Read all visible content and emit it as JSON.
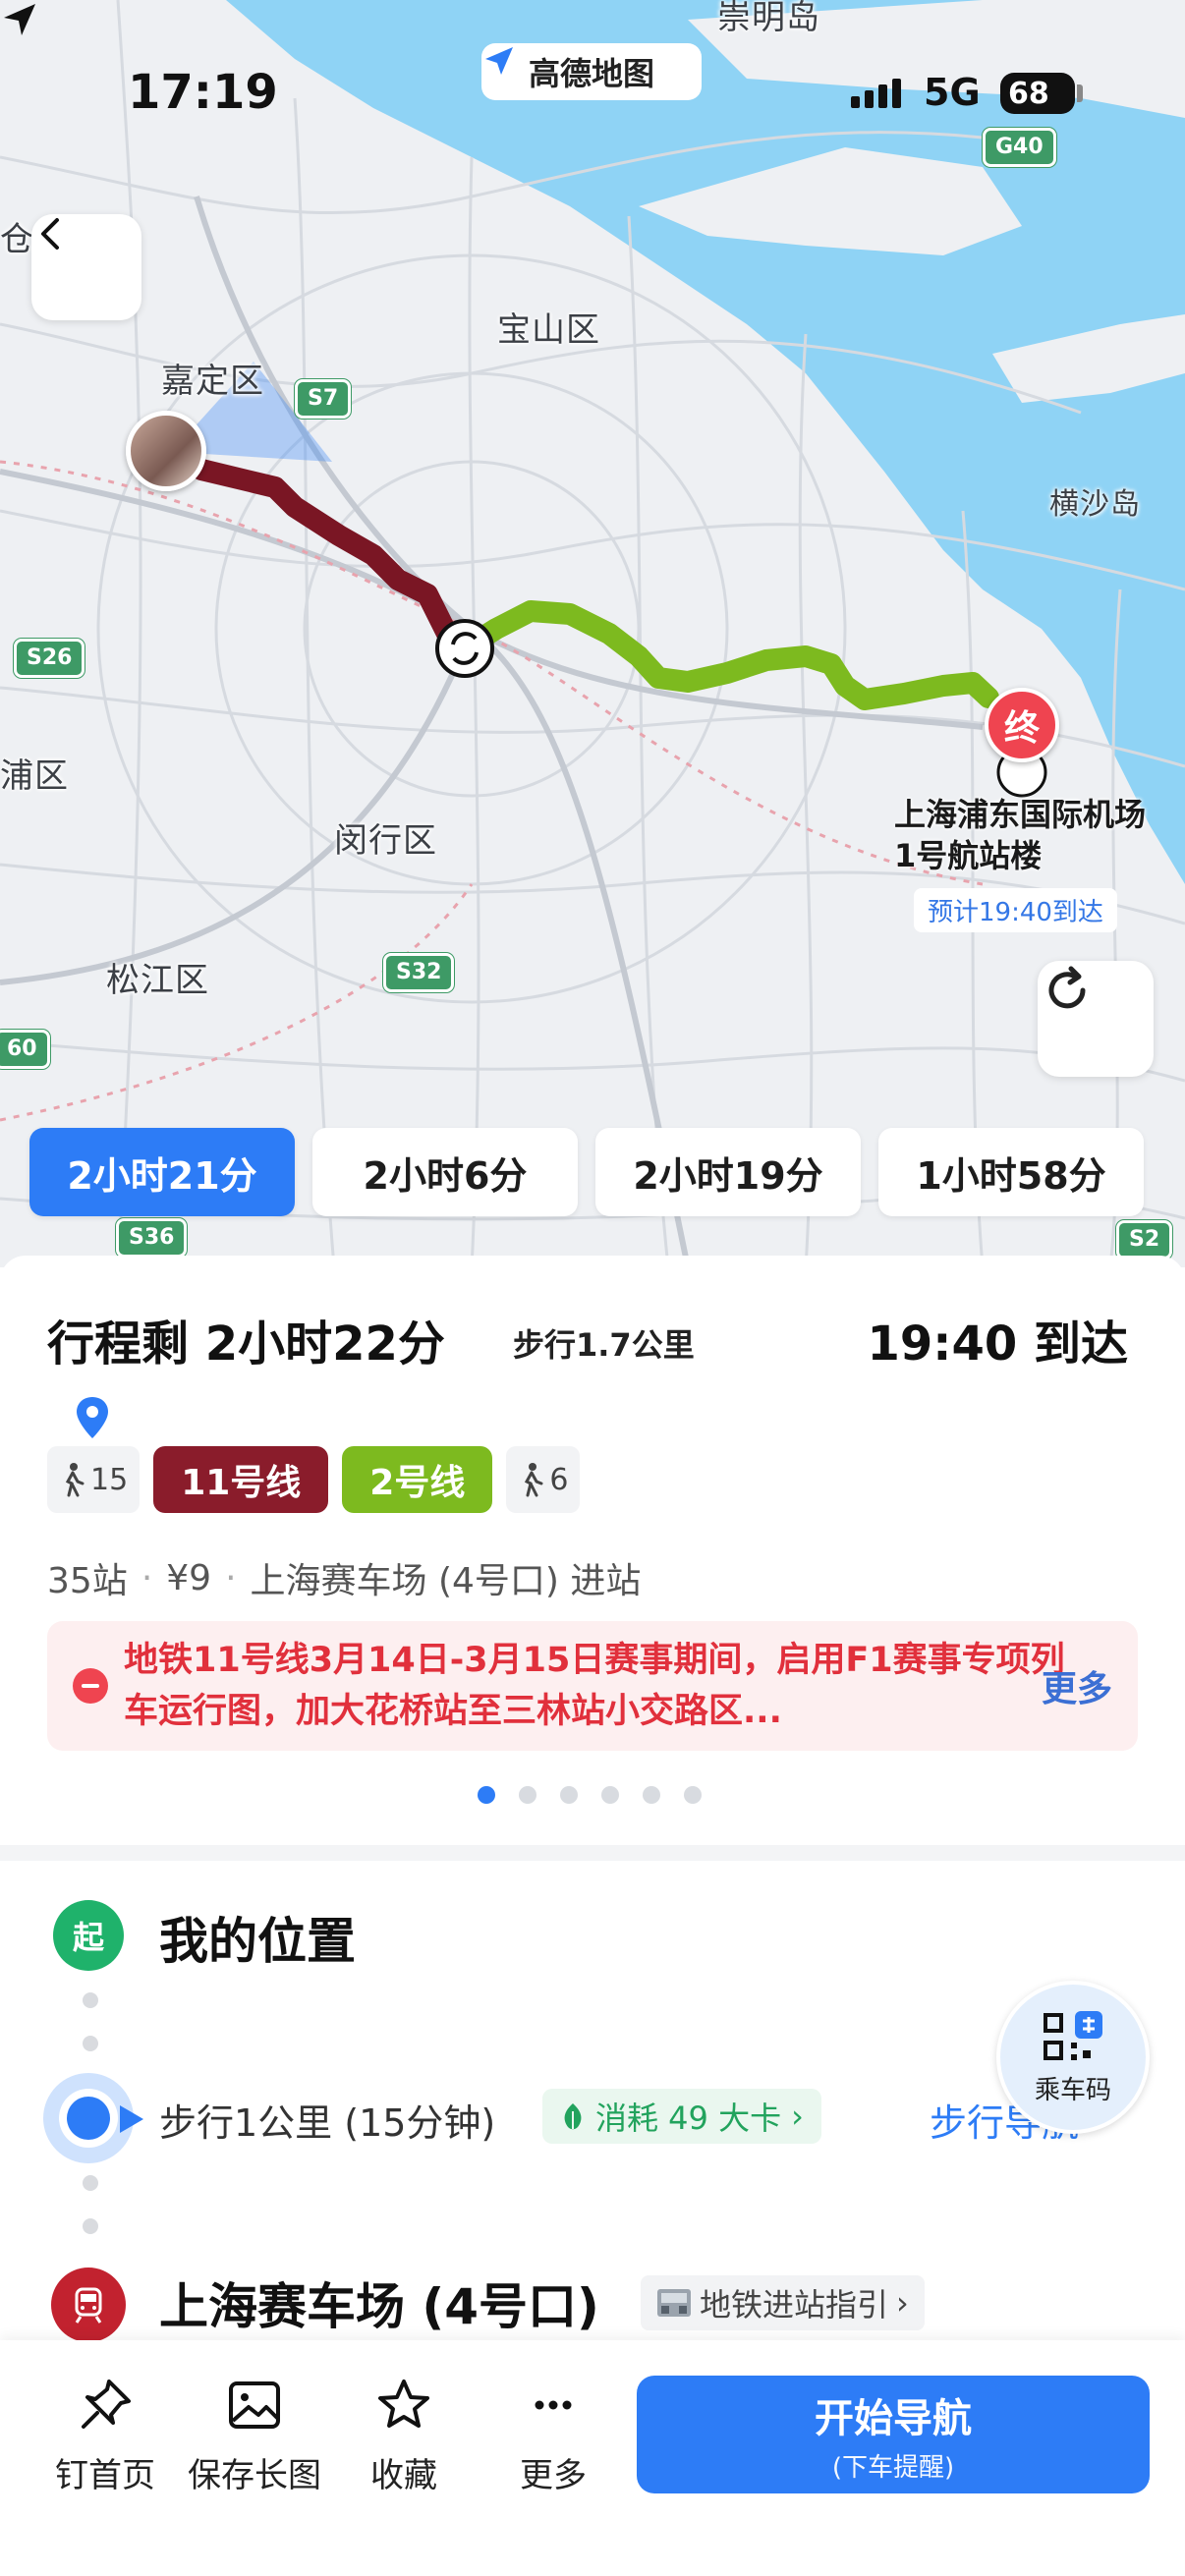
{
  "status_bar": {
    "time": "17:19",
    "network": "5G",
    "battery": "68"
  },
  "app_badge": {
    "name": "高德地图"
  },
  "map": {
    "labels": {
      "jingmingdao": "崇明岛",
      "baoshan": "宝山区",
      "jiading": "嘉定区",
      "hengsha": "横沙岛",
      "minhang": "闵行区",
      "songjiang": "松江区",
      "qingpu": "浦区",
      "cang": "仓"
    },
    "shields": {
      "g40": "G40",
      "s7": "S7",
      "s26": "S26",
      "s32": "S32",
      "s36": "S36",
      "s2": "S2",
      "s60": "60"
    },
    "destination": {
      "end_marker": "终",
      "name": "上海浦东国际机场1号航站楼",
      "eta": "预计19:40到达"
    }
  },
  "route_options": [
    {
      "label": "2小时21分",
      "active": true
    },
    {
      "label": "2小时6分",
      "active": false
    },
    {
      "label": "2小时19分",
      "active": false
    },
    {
      "label": "1小时58分",
      "active": false
    }
  ],
  "summary": {
    "remaining": "行程剩 2小时22分",
    "walk_distance": "步行1.7公里",
    "arrival": "19:40 到达",
    "legs": {
      "walk_start": "15",
      "line1": "11号线",
      "line2": "2号线",
      "walk_end": "6"
    },
    "colors": {
      "line11": "#8a1c2b",
      "line2": "#7dba1f",
      "accent": "#2d7cf6"
    },
    "meta": {
      "stops": "35站",
      "fare": "¥9",
      "entrance": "上海赛车场 (4号口) 进站"
    },
    "notice": {
      "text": "地铁11号线3月14日-3月15日赛事期间，启用F1赛事专项列车运行图，加大花桥站至三林站小交路区...",
      "more": "更多"
    },
    "pager": {
      "count": 6,
      "current": 0
    }
  },
  "steps": {
    "start_badge": "起",
    "start_title": "我的位置",
    "walk_text": "步行1公里 (15分钟)",
    "calorie": "消耗 49 大卡",
    "walk_nav": "步行导航",
    "qr_label": "乘车码",
    "station_title": "上海赛车场 (4号口)",
    "guide": "地铁进站指引"
  },
  "bottom_bar": {
    "pin": "钉首页",
    "save": "保存长图",
    "favorite": "收藏",
    "more": "更多",
    "start_nav": "开始导航",
    "start_nav_sub": "(下车提醒)"
  }
}
